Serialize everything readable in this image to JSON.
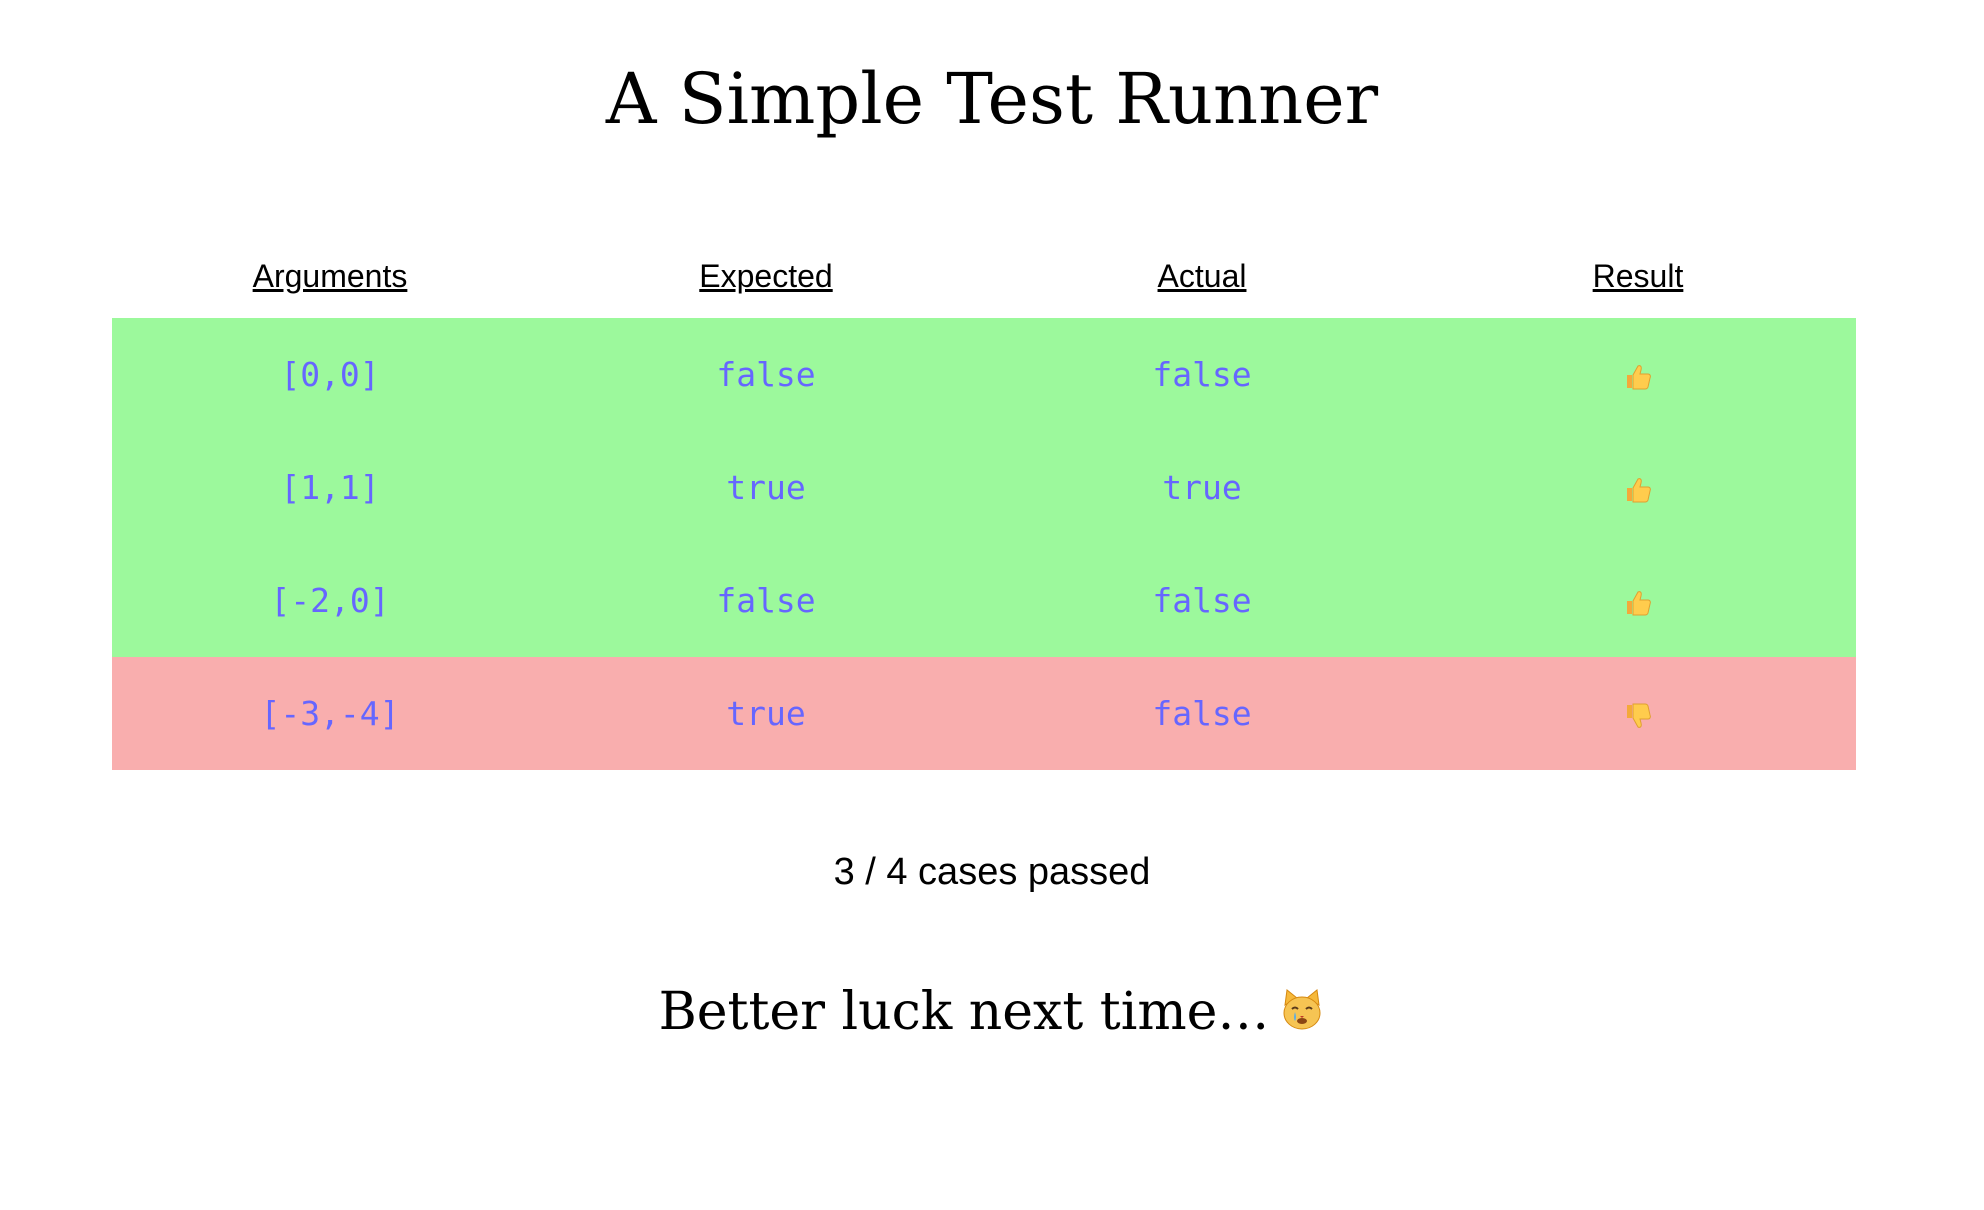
{
  "page": {
    "title": "A Simple Test Runner"
  },
  "table": {
    "headers": [
      "Arguments",
      "Expected",
      "Actual",
      "Result"
    ],
    "rows": [
      {
        "arguments": "[0,0]",
        "expected": "false",
        "actual": "false",
        "result": "pass",
        "result_icon": "thumbs-up-icon"
      },
      {
        "arguments": "[1,1]",
        "expected": "true",
        "actual": "true",
        "result": "pass",
        "result_icon": "thumbs-up-icon"
      },
      {
        "arguments": "[-2,0]",
        "expected": "false",
        "actual": "false",
        "result": "pass",
        "result_icon": "thumbs-up-icon"
      },
      {
        "arguments": "[-3,-4]",
        "expected": "true",
        "actual": "false",
        "result": "fail",
        "result_icon": "thumbs-down-icon"
      }
    ]
  },
  "summary": {
    "text": "3 / 4 cases passed"
  },
  "message": {
    "text": "Better luck next time…",
    "icon": "crying-cat-icon"
  },
  "colors": {
    "pass_row": "#9cf99c",
    "fail_row": "#f9aeae",
    "code_text": "#6666ff"
  }
}
